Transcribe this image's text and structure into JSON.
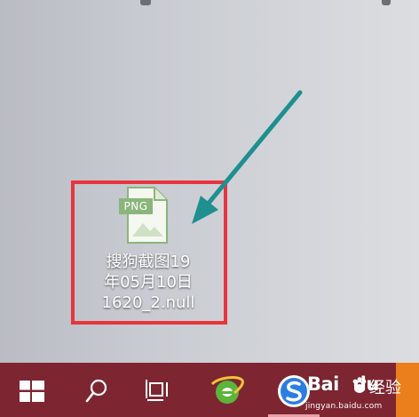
{
  "desktop": {
    "file": {
      "badge": "PNG",
      "name_lines": [
        "搜狗截图19",
        "年05月10日",
        "1620_2.null"
      ]
    },
    "highlight_color": "#e8343d",
    "arrow_color": "#1f8f8f"
  },
  "taskbar": {
    "color": "#7d2631",
    "items": [
      {
        "name": "windows-start",
        "icon": "windows-logo-icon"
      },
      {
        "name": "search",
        "icon": "search-icon"
      },
      {
        "name": "task-view",
        "icon": "task-view-icon"
      },
      {
        "name": "browser",
        "icon": "ie-browser-icon"
      },
      {
        "name": "sogou",
        "icon": "sogou-browser-icon"
      }
    ]
  },
  "watermark": {
    "brand": "Bai",
    "brand_suffix": "du",
    "product": "经验",
    "url": "jingyan.baidu.com"
  }
}
